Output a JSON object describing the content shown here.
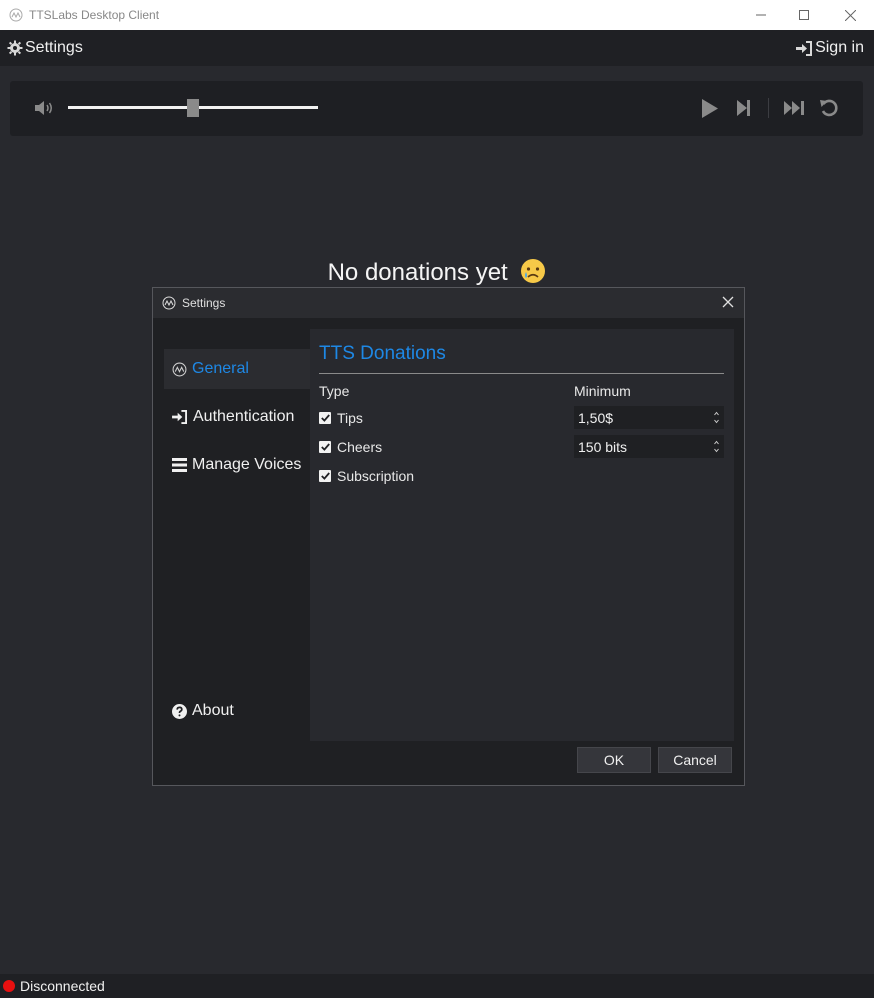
{
  "window": {
    "title": "TTSLabs Desktop Client",
    "controls": [
      "minimize",
      "maximize",
      "close"
    ]
  },
  "topbar": {
    "settings_label": "Settings",
    "signin_label": "Sign in"
  },
  "player": {
    "volume_level": 0.5
  },
  "main": {
    "empty_message": "No donations yet",
    "empty_emoji": "😥"
  },
  "dialog": {
    "title": "Settings",
    "nav": [
      {
        "label": "General",
        "icon": "app-logo-icon",
        "active": true
      },
      {
        "label": "Authentication",
        "icon": "sign-in-icon",
        "active": false
      },
      {
        "label": "Manage Voices",
        "icon": "list-icon",
        "active": false
      }
    ],
    "about_label": "About",
    "panel": {
      "heading": "TTS Donations",
      "col_type": "Type",
      "col_minimum": "Minimum",
      "rows": [
        {
          "label": "Tips",
          "checked": true,
          "minimum": "1,50$"
        },
        {
          "label": "Cheers",
          "checked": true,
          "minimum": "150 bits"
        },
        {
          "label": "Subscription",
          "checked": true
        }
      ]
    },
    "ok_label": "OK",
    "cancel_label": "Cancel"
  },
  "status": {
    "text": "Disconnected",
    "color": "#e81010"
  },
  "colors": {
    "accent": "#1e88e5",
    "background": "#28292e"
  }
}
